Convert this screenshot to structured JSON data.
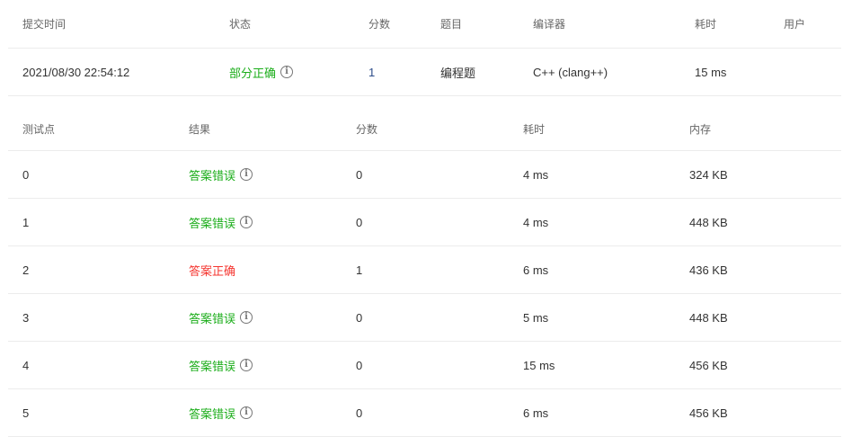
{
  "submission": {
    "headers": [
      "提交时间",
      "状态",
      "分数",
      "题目",
      "编译器",
      "耗时",
      "用户"
    ],
    "time": "2021/08/30 22:54:12",
    "status": "部分正确",
    "score": "1",
    "problem": "编程题",
    "compiler": "C++ (clang++)",
    "duration": "15 ms",
    "user": ""
  },
  "testcases": {
    "headers": [
      "测试点",
      "结果",
      "分数",
      "耗时",
      "内存"
    ],
    "rows": [
      {
        "id": "0",
        "result": "答案错误",
        "status": "wrong",
        "score": "0",
        "time": "4 ms",
        "memory": "324 KB"
      },
      {
        "id": "1",
        "result": "答案错误",
        "status": "wrong",
        "score": "0",
        "time": "4 ms",
        "memory": "448 KB"
      },
      {
        "id": "2",
        "result": "答案正确",
        "status": "correct",
        "score": "1",
        "time": "6 ms",
        "memory": "436 KB"
      },
      {
        "id": "3",
        "result": "答案错误",
        "status": "wrong",
        "score": "0",
        "time": "5 ms",
        "memory": "448 KB"
      },
      {
        "id": "4",
        "result": "答案错误",
        "status": "wrong",
        "score": "0",
        "time": "15 ms",
        "memory": "456 KB"
      },
      {
        "id": "5",
        "result": "答案错误",
        "status": "wrong",
        "score": "0",
        "time": "6 ms",
        "memory": "456 KB"
      }
    ]
  },
  "colors": {
    "wrong": "#1aad19",
    "correct": "#f5352f",
    "partial": "#1aad19"
  }
}
